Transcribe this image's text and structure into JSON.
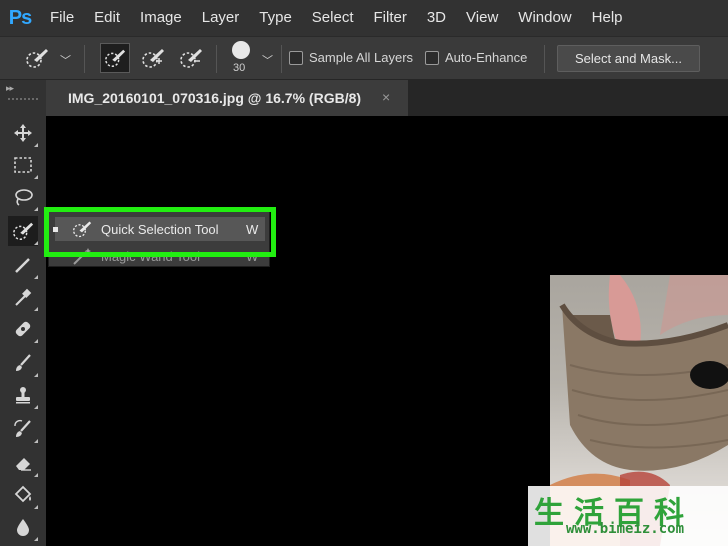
{
  "app": {
    "logo": "Ps"
  },
  "menu": [
    "File",
    "Edit",
    "Image",
    "Layer",
    "Type",
    "Select",
    "Filter",
    "3D",
    "View",
    "Window",
    "Help"
  ],
  "options": {
    "brush_size": "30",
    "sample_all_layers": "Sample All Layers",
    "auto_enhance": "Auto-Enhance",
    "select_and_mask": "Select and Mask..."
  },
  "document": {
    "tab_title": "IMG_20160101_070316.jpg @ 16.7% (RGB/8)",
    "close_glyph": "×"
  },
  "flyout": {
    "items": [
      {
        "label": "Quick Selection Tool",
        "shortcut": "W",
        "selected": true
      },
      {
        "label": "Magic Wand Tool",
        "shortcut": "W",
        "selected": false
      }
    ]
  },
  "panel": {
    "collapse_glyph": "▸▸"
  },
  "watermark": {
    "chars": "生活百科",
    "url": "www.bimeiz.com"
  },
  "colors": {
    "highlight": "#22ee11",
    "accent": "#31a8ff"
  }
}
